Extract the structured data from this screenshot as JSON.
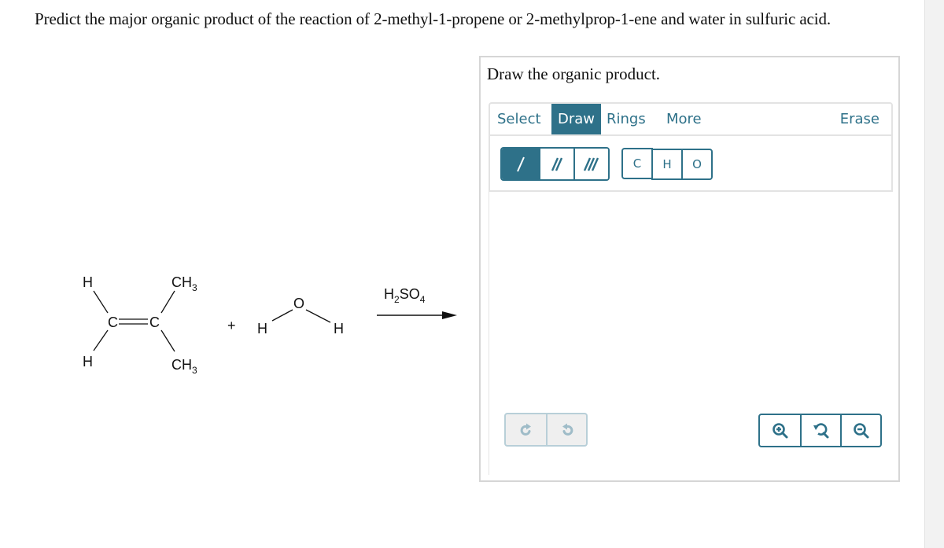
{
  "question": {
    "text": "Predict the major organic product of the reaction of 2-methyl-1-propene or 2-methylprop-1-ene and water in sulfuric acid."
  },
  "scheme": {
    "reactant1": {
      "name": "2-methyl-1-propene",
      "labels": {
        "h_top": "H",
        "h_bottom": "H",
        "c_left": "C",
        "c_right": "C",
        "ch3_top": "CH",
        "ch3_top_sub": "3",
        "ch3_bottom": "CH",
        "ch3_bottom_sub": "3"
      }
    },
    "plus": "+",
    "reactant2": {
      "name": "water",
      "labels": {
        "h_left": "H",
        "o": "O",
        "h_right": "H"
      }
    },
    "reagent": {
      "h": "H",
      "h_sub": "2",
      "so": "SO",
      "o_sub": "4"
    }
  },
  "panel": {
    "title": "Draw the organic product.",
    "tabs": [
      {
        "label": "Select",
        "active": false
      },
      {
        "label": "Draw",
        "active": true
      },
      {
        "label": "Rings",
        "active": false
      },
      {
        "label": "More",
        "active": false
      }
    ],
    "erase_label": "Erase",
    "bond_tools": [
      {
        "name": "single-bond",
        "active": true
      },
      {
        "name": "double-bond",
        "active": false
      },
      {
        "name": "triple-bond",
        "active": false
      }
    ],
    "atom_tools": [
      "C",
      "H",
      "O"
    ],
    "history": [
      {
        "name": "redo-icon",
        "enabled": false
      },
      {
        "name": "undo-icon",
        "enabled": false
      }
    ],
    "zoom_tools": [
      "zoom-in-icon",
      "zoom-reset-icon",
      "zoom-out-icon"
    ],
    "colors": {
      "accent": "#2e7189",
      "disabled": "#b8cfd8",
      "border": "#d6d6d6"
    }
  }
}
